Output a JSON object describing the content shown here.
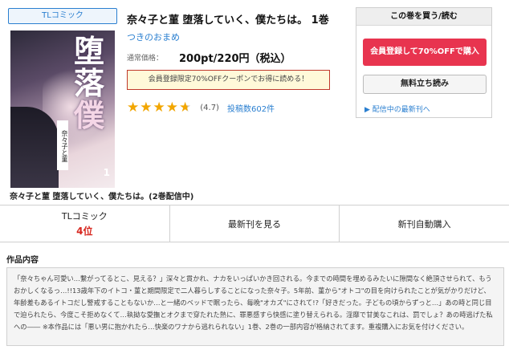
{
  "genre_tag": "TLコミック",
  "cover": {
    "title_glyphs": [
      "堕",
      "落",
      "し",
      "て",
      "い",
      "く",
      "僕",
      "た",
      "ち",
      "は"
    ],
    "author_band": "奈々子と菫",
    "volume": "1"
  },
  "book": {
    "title": "奈々子と菫 堕落していく、僕たちは。 1巻",
    "author": "つきのおまめ",
    "price_label": "通常価格：",
    "price": "200pt/220円（税込）",
    "coupon_text": "会員登録限定70%OFFクーポンでお得に読める！",
    "rating_value": "(4.7)",
    "rating_stars": 4.7,
    "review_count": "投稿数602件",
    "series_line": "奈々子と菫 堕落していく、僕たちは。(2巻配信中)"
  },
  "buy_panel": {
    "header": "この巻を買う/読む",
    "register_button": "会員登録して70%OFFで購入",
    "trial_button": "無料立ち読み",
    "latest_link": "▶ 配信中の最新刊へ"
  },
  "action_bar": {
    "ranking_label": "TLコミック",
    "ranking_value": "4位",
    "latest_button": "最新刊を見る",
    "auto_buy_button": "新刊自動購入"
  },
  "description": {
    "heading": "作品内容",
    "text": "「奈々ちゃん可愛い…繋がってるとこ、見える？」深々と貫かれ、ナカをいっぱいかき回される。今までの時間を埋めるみたいに隙間なく絶頂させられて、もうおかしくなるっ…!!13歳年下のイトコ・菫と期間限定で二人暮らしすることになった奈々子。5年前、菫から\"オトコ\"の目を向けられたことが気がかりだけど、年齢差もあるイトコだし警戒することもないか…と一緒のベッドで眠ったら、毎晩\"オカズ\"にされて!?「好きだった。子どもの頃からずっと…」あの時と同じ目で迫られたら、今度こそ拒めなくて…執拗な愛撫とオクまで穿たれた熱に、罪悪感すら快感に塗り替えられる。淫靡で甘美なこれは、罰でしょ？あの時逃げた私への―― ※本作品には「悪い男に抱かれたら…快楽のワナから逃れられない」1巻、2巻の一部内容が格納されてます。重複購入にお気を付けください。"
  },
  "colors": {
    "accent_blue": "#2a7fd0",
    "buy_red": "#e8344f",
    "rank_red": "#d7271f",
    "star_gold": "#f2a600"
  }
}
